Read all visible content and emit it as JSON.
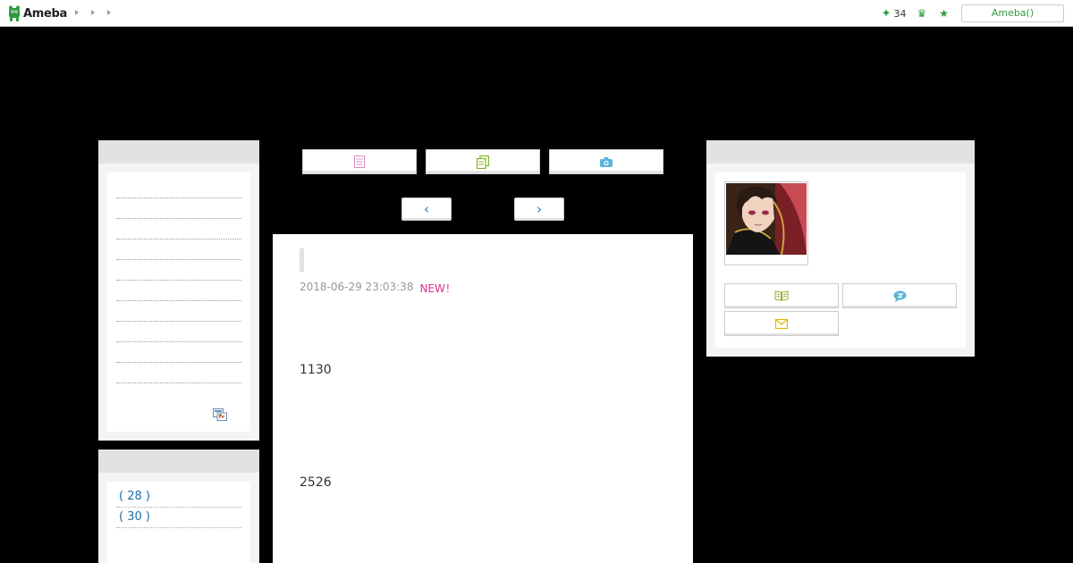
{
  "header": {
    "logo_text": "Ameba",
    "star_count": "34",
    "ameba_button_label": "Ameba()"
  },
  "article": {
    "date": "2018-06-29 23:03:38",
    "new_badge": "NEW！",
    "body_lines": [
      "1130",
      "2526"
    ]
  },
  "theme_list": {
    "items": [
      {
        "label": "( 28 )"
      },
      {
        "label": "( 30 )"
      }
    ]
  },
  "colors": {
    "brand_green": "#2d9b3d",
    "new_pink": "#e02c8a",
    "link_blue": "#1b6ea8"
  },
  "icons": {
    "entry_list": "document-list-icon",
    "copy": "copy-pages-icon",
    "photo": "camera-icon",
    "prev": "chevron-left-icon",
    "next": "chevron-right-icon",
    "reader": "open-book-icon",
    "message": "chat-bubble-icon",
    "mail": "envelope-icon",
    "rss": "rss-feed-icon"
  }
}
